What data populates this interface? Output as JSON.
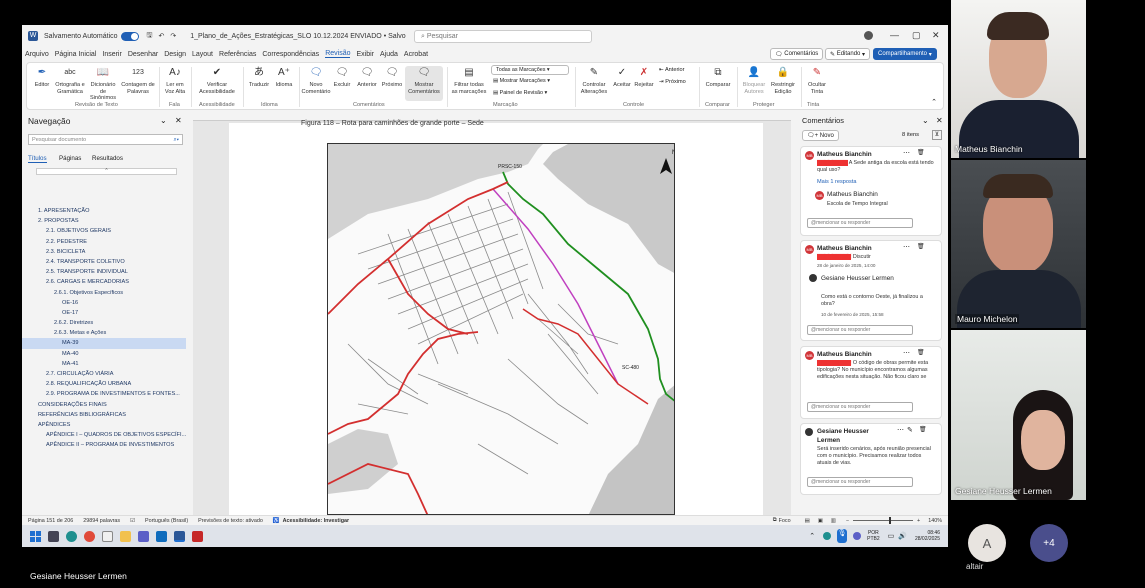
{
  "word": {
    "autosave_label": "Salvamento Automático",
    "filename": "1_Plano_de_Ações_Estratégicas_SLO 10.12.2024 ENVIADO",
    "saved": "• Salvo",
    "search_placeholder": "Pesquisar",
    "menus": [
      "Arquivo",
      "Página Inicial",
      "Inserir",
      "Desenhar",
      "Design",
      "Layout",
      "Referências",
      "Correspondências",
      "Revisão",
      "Exibir",
      "Ajuda",
      "Acrobat"
    ],
    "active_menu": "Revisão",
    "comments_btn": "Comentários",
    "editing_btn": "Editando",
    "share_btn": "Compartilhamento",
    "ribbon": {
      "editor": "Editor",
      "ortografia": "Ortografia e Gramática",
      "dicionario": "Dicionário de Sinônimos",
      "contagem": "Contagem de Palavras",
      "ler": "Ler em Voz Alta",
      "verificar": "Verificar Acessibilidade",
      "traduzir": "Traduzir",
      "idioma": "Idioma",
      "novo_comentario": "Novo Comentário",
      "excluir": "Excluir",
      "anterior": "Anterior",
      "proximo": "Próximo",
      "mostrar_comentarios": "Mostrar Comentários",
      "filtrar": "Filtrar todas as marcações",
      "todas_marcacoes": "Todas as Marcações",
      "mostrar_marcacoes": "Mostrar Marcações",
      "painel_revisao": "Painel de Revisão",
      "controlar": "Controlar Alterações",
      "aceitar": "Aceitar",
      "rejeitar": "Rejeitar",
      "anterior2": "Anterior",
      "proximo2": "Próximo",
      "comparar": "Comparar",
      "bloquear": "Bloquear Autores",
      "restringir": "Restringir Edição",
      "ocultar": "Ocultar Tinta",
      "groups": [
        "Revisão de Texto",
        "Fala",
        "Acessibilidade",
        "Idioma",
        "Comentários",
        "Marcação",
        "Controle",
        "Comparar",
        "Proteger",
        "Tinta"
      ]
    },
    "nav": {
      "title": "Navegação",
      "search_placeholder": "Pesquisar documento",
      "tabs": [
        "Títulos",
        "Páginas",
        "Resultados"
      ],
      "items": [
        {
          "text": "1. APRESENTAÇÃO",
          "indent": 0
        },
        {
          "text": "2. PROPOSTAS",
          "indent": 0
        },
        {
          "text": "2.1. OBJETIVOS GERAIS",
          "indent": 1
        },
        {
          "text": "2.2. PEDESTRE",
          "indent": 1
        },
        {
          "text": "2.3. BICICLETA",
          "indent": 1
        },
        {
          "text": "2.4. TRANSPORTE COLETIVO",
          "indent": 1
        },
        {
          "text": "2.5. TRANSPORTE INDIVIDUAL",
          "indent": 1
        },
        {
          "text": "2.6. CARGAS E MERCADORIAS",
          "indent": 1
        },
        {
          "text": "2.6.1. Objetivos Específicos",
          "indent": 2
        },
        {
          "text": "OE-16",
          "indent": 3
        },
        {
          "text": "OE-17",
          "indent": 3
        },
        {
          "text": "2.6.2. Diretrizes",
          "indent": 2
        },
        {
          "text": "2.6.3. Metas e Ações",
          "indent": 2
        },
        {
          "text": "MA-39",
          "indent": 3
        },
        {
          "text": "MA-40",
          "indent": 3
        },
        {
          "text": "MA-41",
          "indent": 3
        },
        {
          "text": "2.7. CIRCULAÇÃO VIÁRIA",
          "indent": 1
        },
        {
          "text": "2.8. REQUALIFICAÇÃO URBANA",
          "indent": 1
        },
        {
          "text": "2.9. PROGRAMA DE INVESTIMENTOS E FONTES...",
          "indent": 1
        },
        {
          "text": "CONSIDERAÇÕES FINAIS",
          "indent": 0
        },
        {
          "text": "REFERÊNCIAS BIBLIOGRÁFICAS",
          "indent": 0
        },
        {
          "text": "APÊNDICES",
          "indent": 0
        },
        {
          "text": "APÊNDICE I – QUADROS DE OBJETIVOS ESPECÍFI...",
          "indent": 1
        },
        {
          "text": "APÊNDICE II – PROGRAMA DE INVESTIMENTOS",
          "indent": 1
        }
      ]
    },
    "doc": {
      "figure_caption": "Figura 118 – Rota para caminhões de grande porte – Sede",
      "map_labels": [
        "PRSC-150",
        "SC-480",
        "N"
      ]
    },
    "comments_pane": {
      "title": "Comentários",
      "new_btn": "Novo",
      "count": "8 itens",
      "cards": [
        {
          "author": "Matheus Bianchin",
          "text": "A Sede antiga da escola está tendo qual uso?",
          "link": "Mais 1 resposta",
          "reply_author": "Matheus Bianchin",
          "reply_text": "Escola de Tempo Integral",
          "reply_placeholder": "@mencionar ou responder"
        },
        {
          "author": "Matheus Bianchin",
          "text": "Discutir",
          "date": "28 de janeiro de 2025, 14:00",
          "reply_author": "Gesiane Heusser Lermen",
          "reply_text": "Como está o contorno Oeste, já finalizou a obra?",
          "reply_date": "10 de fevereiro de 2025, 15:58",
          "reply_placeholder": "@mencionar ou responder"
        },
        {
          "author": "Matheus Bianchin",
          "text": "O código de obras permite esta tipologia? No município encontramos algumas edificações nesta situação. Não ficou claro se",
          "reply_placeholder": "@mencionar ou responder"
        },
        {
          "author": "Gesiane Heusser Lermen",
          "text": "Será inserido cenários, após reunião presencial com o município. Precisamos realizar todos atuais de vias.",
          "reply_placeholder": "@mencionar ou responder"
        }
      ]
    },
    "status": {
      "page": "Página 151 de 206",
      "words": "29894 palavras",
      "lang": "Português (Brasil)",
      "predict": "Previsões de texto: ativado",
      "access": "Acessibilidade: Investigar",
      "focus": "Foco",
      "zoom": "140%"
    },
    "taskbar": {
      "lang1": "POR",
      "lang2": "PTB2",
      "time": "08:46",
      "date": "28/02/2025"
    }
  },
  "participants": [
    {
      "name": "Matheus Bianchin"
    },
    {
      "name": "Mauro Michelon"
    },
    {
      "name": "Gesiane Heusser Lermen"
    }
  ],
  "extra": {
    "avatar_letter": "A",
    "avatar_name": "altair",
    "more": "+4"
  },
  "presenter": "Gesiane Heusser Lermen"
}
